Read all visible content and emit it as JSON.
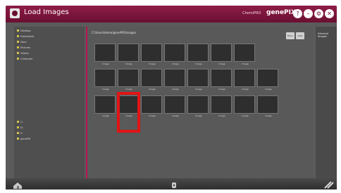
{
  "window": {
    "title": "Load Images",
    "brand_small": "ChemiPRO",
    "brand_big": "genePIX",
    "buttons": [
      {
        "name": "help",
        "label": "?"
      },
      {
        "name": "minimize",
        "label": "–"
      },
      {
        "name": "settings",
        "label": "⚙"
      },
      {
        "name": "close",
        "label": "✕"
      }
    ]
  },
  "main": {
    "path": "C:\\Users\\demo\\genePIX\\images",
    "top_buttons": [
      {
        "label": "Move"
      },
      {
        "label": "Date"
      }
    ]
  },
  "right_pane": {
    "title": "Selected Images"
  },
  "sidebar": {
    "tree": [
      {
        "label": "Desktop"
      },
      {
        "label": "Downloads"
      },
      {
        "label": "Docs"
      },
      {
        "label": "Pictures"
      },
      {
        "label": "Videos"
      },
      {
        "label": "Computer"
      },
      {
        "label": "C:"
      },
      {
        "label": "D:"
      },
      {
        "label": "E:"
      },
      {
        "label": "genePIX"
      }
    ]
  },
  "thumbnails": {
    "row1": [
      {
        "caption": "Image",
        "subcaption": ""
      },
      {
        "caption": "Image",
        "subcaption": ""
      },
      {
        "caption": "Image",
        "subcaption": ""
      },
      {
        "caption": "Image",
        "subcaption": ""
      },
      {
        "caption": "Image",
        "subcaption": ""
      },
      {
        "caption": "Image",
        "subcaption": ""
      },
      {
        "caption": "Image",
        "subcaption": ""
      }
    ],
    "row2": [
      {
        "caption": "Image",
        "subcaption": ""
      },
      {
        "caption": "Image",
        "subcaption": ""
      },
      {
        "caption": "Image",
        "subcaption": ""
      },
      {
        "caption": "Image",
        "subcaption": ""
      },
      {
        "caption": "Image",
        "subcaption": ""
      },
      {
        "caption": "Image",
        "subcaption": ""
      },
      {
        "caption": "Image",
        "subcaption": ""
      },
      {
        "caption": "Image",
        "subcaption": ""
      }
    ],
    "row3": [
      {
        "caption": "Image",
        "subcaption": ""
      },
      {
        "caption": "Image",
        "subcaption": ""
      },
      {
        "caption": "Image",
        "subcaption": ""
      },
      {
        "caption": "Image",
        "subcaption": ""
      },
      {
        "caption": "Image",
        "subcaption": ""
      },
      {
        "caption": "Image",
        "subcaption": ""
      },
      {
        "caption": "Image",
        "subcaption": ""
      },
      {
        "caption": "Image",
        "subcaption": ""
      }
    ]
  },
  "bottom": {
    "icons": [
      {
        "name": "home-icon"
      },
      {
        "name": "device-icon"
      },
      {
        "name": "tools-icon"
      }
    ]
  },
  "colors": {
    "accent": "#b6124f",
    "titlebar": "#6a0f31",
    "highlight": "#e11414"
  }
}
